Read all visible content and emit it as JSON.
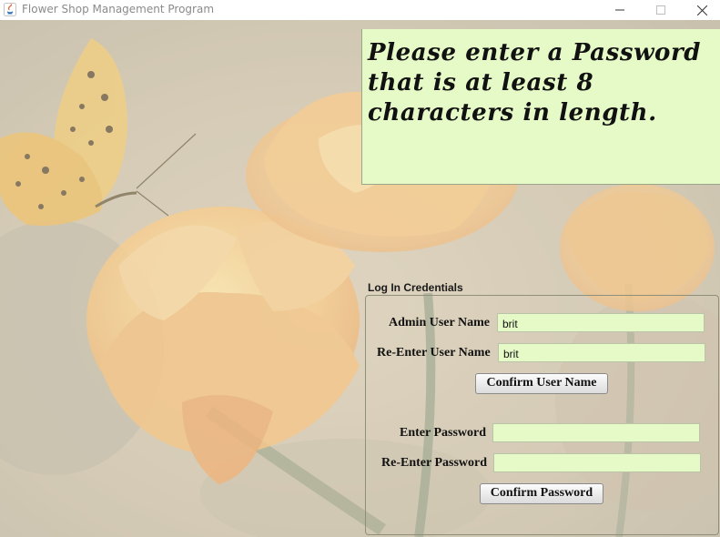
{
  "window": {
    "title": "Flower Shop Management Program",
    "controls": [
      "minimize-icon",
      "maximize-icon",
      "close-icon"
    ]
  },
  "message": {
    "text": "Please enter a Password that is at least 8 characters in length."
  },
  "credentials": {
    "title": "Log In Credentials",
    "admin_user_label": "Admin User Name",
    "admin_user_value": "brit",
    "reenter_user_label": "Re-Enter User Name",
    "reenter_user_value": "brit",
    "confirm_user_button": "Confirm User Name",
    "password_label": "Enter Password",
    "password_value": "",
    "reenter_password_label": "Re-Enter Password",
    "reenter_password_value": "",
    "confirm_password_button": "Confirm Password"
  },
  "colors": {
    "field_bg": "#e6fac8",
    "message_bg": "#e6fac8"
  }
}
